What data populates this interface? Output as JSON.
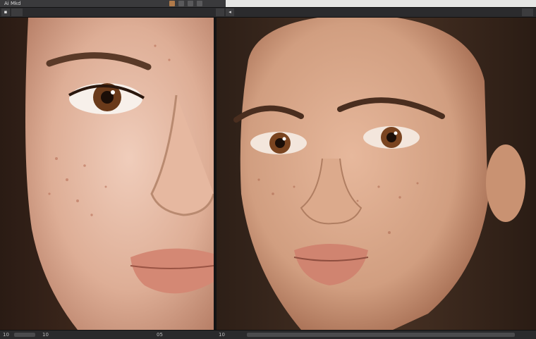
{
  "app": {
    "title_label": "Ai Mkd",
    "theme_colors": {
      "chrome": "#3a3a3c",
      "canvas": "#1d1d1f",
      "status": "#2a2a2c"
    }
  },
  "tabs": [
    {
      "label": "▪",
      "icon": "doc-icon"
    },
    {
      "label": "",
      "icon": "doc-icon"
    },
    {
      "label": "",
      "icon": "doc-icon"
    },
    {
      "label": "◂",
      "icon": "arrow-icon"
    },
    {
      "label": "",
      "icon": "window-icon"
    }
  ],
  "left_panel": {
    "description_icon": "portrait-image"
  },
  "right_panel": {
    "description_icon": "portrait-image"
  },
  "statusbar": {
    "left_readout": "10",
    "left_readout_2": "10",
    "mid_readout": "05",
    "right_readout": "10",
    "right_readout_2": ""
  }
}
